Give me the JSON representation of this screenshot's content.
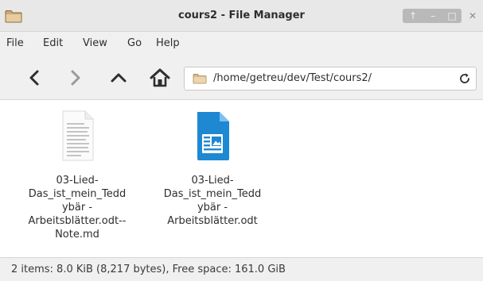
{
  "window": {
    "title": "cours2 - File Manager",
    "controls": {
      "sticky": "↑",
      "minimize": "–",
      "maximize": "□",
      "close": "✕"
    }
  },
  "menu": {
    "items": [
      {
        "label": "File"
      },
      {
        "label": "Edit"
      },
      {
        "label": "View"
      },
      {
        "label": "Go"
      },
      {
        "label": "Help"
      }
    ]
  },
  "toolbar": {
    "back_icon": "chevron-left-icon",
    "forward_icon": "chevron-right-icon",
    "up_icon": "chevron-up-icon",
    "home_icon": "home-icon",
    "reload_icon": "reload-icon",
    "location": "/home/getreu/dev/Test/cours2/"
  },
  "files": [
    {
      "icon": "text-document-icon",
      "name_lines": [
        "03-Lied-",
        "Das_ist_mein_Tedd",
        "ybär -",
        "Arbeitsblätter.odt--",
        "Note.md"
      ]
    },
    {
      "icon": "writer-document-icon",
      "name_lines": [
        "03-Lied-",
        "Das_ist_mein_Tedd",
        "ybär -",
        "Arbeitsblätter.odt"
      ]
    }
  ],
  "status": {
    "text": "2 items: 8.0 KiB (8,217 bytes), Free space: 161.0 GiB"
  },
  "colors": {
    "accent_blue": "#1e88d2",
    "folder_tan": "#d8b98a"
  }
}
